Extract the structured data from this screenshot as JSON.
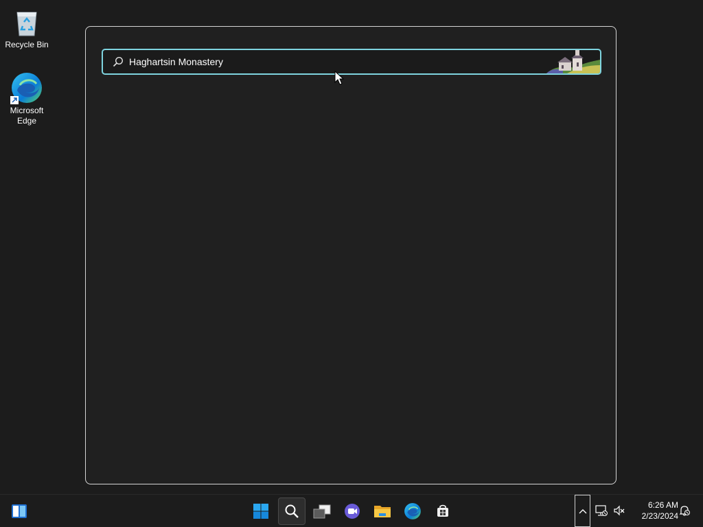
{
  "desktop": {
    "icons": [
      {
        "label": "Recycle Bin",
        "icon": "recycle-bin-icon"
      },
      {
        "label": "Microsoft Edge",
        "icon": "edge-icon"
      }
    ]
  },
  "search": {
    "query": "Haghartsin Monastery",
    "icon": "search-icon",
    "highlight_image": "monastery-illustration"
  },
  "taskbar": {
    "items": [
      {
        "name": "widgets",
        "icon": "widgets-icon"
      },
      {
        "name": "start",
        "icon": "windows-start-icon"
      },
      {
        "name": "search",
        "icon": "search-icon",
        "active": true
      },
      {
        "name": "task-view",
        "icon": "task-view-icon"
      },
      {
        "name": "teams-chat",
        "icon": "chat-icon"
      },
      {
        "name": "file-explorer",
        "icon": "folder-icon"
      },
      {
        "name": "edge",
        "icon": "edge-icon"
      },
      {
        "name": "store",
        "icon": "store-icon"
      }
    ],
    "tray": {
      "chevron": "chevron-up-icon",
      "network": "network-disconnected-icon",
      "volume": "volume-muted-icon",
      "notifications": "notification-bell-icon"
    },
    "clock": {
      "time": "6:26 AM",
      "date": "2/23/2024"
    }
  },
  "colors": {
    "accent": "#7fd5e0",
    "windows_blue": "#0078d4"
  }
}
